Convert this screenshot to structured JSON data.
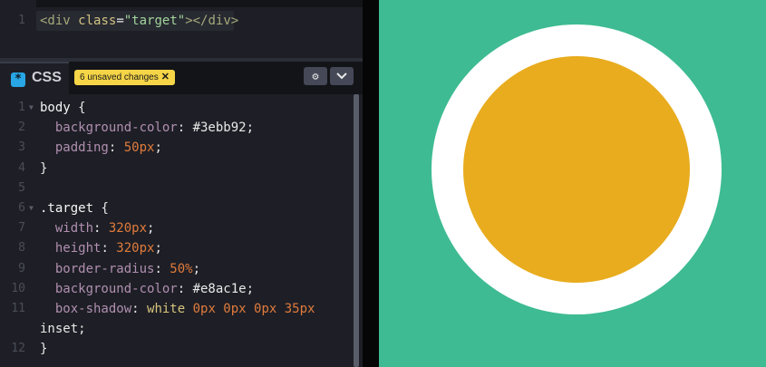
{
  "html_editor": {
    "lines": [
      {
        "n": "1",
        "tokens": [
          {
            "t": "<div ",
            "c": "t-tag"
          },
          {
            "t": "class",
            "c": "t-attr"
          },
          {
            "t": "=",
            "c": "t-pun"
          },
          {
            "t": "\"target\"",
            "c": "t-str"
          },
          {
            "t": "></div>",
            "c": "t-tag"
          }
        ]
      }
    ]
  },
  "css_editor": {
    "tab_label": "CSS",
    "badge_text": "6 unsaved changes",
    "badge_close": "✕",
    "gear_icon": "⚙",
    "chevron_icon": "⌄",
    "lines": [
      {
        "n": "1",
        "fold": true,
        "tokens": [
          {
            "t": "body ",
            "c": "t-sel"
          },
          {
            "t": "{",
            "c": "t-pun"
          }
        ]
      },
      {
        "n": "2",
        "tokens": [
          {
            "t": "  background-color",
            "c": "t-prop"
          },
          {
            "t": ": ",
            "c": "t-pun"
          },
          {
            "t": "#3ebb92",
            "c": "t-val"
          },
          {
            "t": ";",
            "c": "t-pun"
          }
        ]
      },
      {
        "n": "3",
        "tokens": [
          {
            "t": "  padding",
            "c": "t-prop"
          },
          {
            "t": ": ",
            "c": "t-pun"
          },
          {
            "t": "50px",
            "c": "t-num"
          },
          {
            "t": ";",
            "c": "t-pun"
          }
        ]
      },
      {
        "n": "4",
        "tokens": [
          {
            "t": "}",
            "c": "t-pun"
          }
        ]
      },
      {
        "n": "5",
        "tokens": []
      },
      {
        "n": "6",
        "fold": true,
        "tokens": [
          {
            "t": ".target ",
            "c": "t-sel"
          },
          {
            "t": "{",
            "c": "t-pun"
          }
        ]
      },
      {
        "n": "7",
        "tokens": [
          {
            "t": "  width",
            "c": "t-prop"
          },
          {
            "t": ": ",
            "c": "t-pun"
          },
          {
            "t": "320px",
            "c": "t-num"
          },
          {
            "t": ";",
            "c": "t-pun"
          }
        ]
      },
      {
        "n": "8",
        "tokens": [
          {
            "t": "  height",
            "c": "t-prop"
          },
          {
            "t": ": ",
            "c": "t-pun"
          },
          {
            "t": "320px",
            "c": "t-num"
          },
          {
            "t": ";",
            "c": "t-pun"
          }
        ]
      },
      {
        "n": "9",
        "tokens": [
          {
            "t": "  border-radius",
            "c": "t-prop"
          },
          {
            "t": ": ",
            "c": "t-pun"
          },
          {
            "t": "50%",
            "c": "t-num"
          },
          {
            "t": ";",
            "c": "t-pun"
          }
        ]
      },
      {
        "n": "10",
        "tokens": [
          {
            "t": "  background-color",
            "c": "t-prop"
          },
          {
            "t": ": ",
            "c": "t-pun"
          },
          {
            "t": "#e8ac1e",
            "c": "t-val"
          },
          {
            "t": ";",
            "c": "t-pun"
          }
        ]
      },
      {
        "n": "11",
        "tokens": [
          {
            "t": "  box-shadow",
            "c": "t-prop"
          },
          {
            "t": ": ",
            "c": "t-pun"
          },
          {
            "t": "white ",
            "c": "t-kw"
          },
          {
            "t": "0px 0px 0px 35px",
            "c": "t-num"
          }
        ]
      },
      {
        "n": "",
        "tokens": [
          {
            "t": "inset",
            "c": "t-val"
          },
          {
            "t": ";",
            "c": "t-pun"
          }
        ]
      },
      {
        "n": "12",
        "tokens": [
          {
            "t": "}",
            "c": "t-pun"
          }
        ]
      }
    ]
  },
  "preview": {
    "background": "#3ebb92",
    "target_color": "#e8ac1e",
    "shadow_color": "#ffffff"
  }
}
